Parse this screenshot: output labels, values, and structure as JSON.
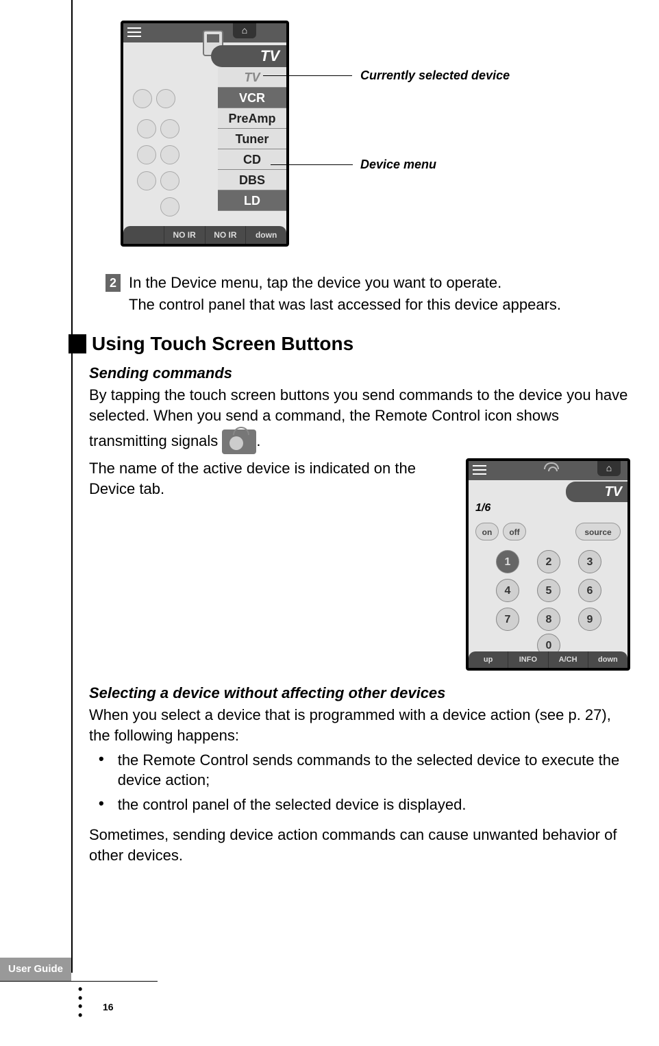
{
  "callouts": {
    "selected_device": "Currently selected device",
    "device_menu": "Device menu"
  },
  "shot1": {
    "tv_tab": "TV",
    "menu_items": [
      "TV",
      "VCR",
      "PreAmp",
      "Tuner",
      "CD",
      "DBS",
      "LD"
    ],
    "bottom": [
      "",
      "NO IR",
      "NO IR",
      "down"
    ]
  },
  "step2": {
    "num": "2",
    "line1": "In the Device menu, tap the device you want to operate.",
    "line2": "The control panel that was last accessed for this device appears."
  },
  "h2": "Using Touch Screen Buttons",
  "sending": {
    "title": "Sending commands",
    "p1a": "By tapping the touch screen buttons you send commands to the device you have selected. When you send a command, the Remote Control icon shows",
    "p1b_before": "transmitting signals ",
    "p1b_after": ".",
    "p2": "The name of the active device is indicated on the Device tab."
  },
  "shot2": {
    "tv_tab": "TV",
    "page": "1/6",
    "on": "on",
    "off": "off",
    "source": "source",
    "keys": [
      "1",
      "2",
      "3",
      "4",
      "5",
      "6",
      "7",
      "8",
      "9",
      "0"
    ],
    "bottom": [
      "up",
      "INFO",
      "A/CH",
      "down"
    ]
  },
  "selecting": {
    "title": "Selecting a device without affecting other devices",
    "intro": "When you select a device that is programmed with a device action (see p. 27), the following happens:",
    "b1": "the Remote Control sends commands to the selected device to execute the device action;",
    "b2": "the control panel of the selected device is displayed.",
    "outro": "Sometimes, sending device action commands can cause unwanted behavior of other devices."
  },
  "footer": {
    "tab": "User Guide",
    "page": "16"
  }
}
